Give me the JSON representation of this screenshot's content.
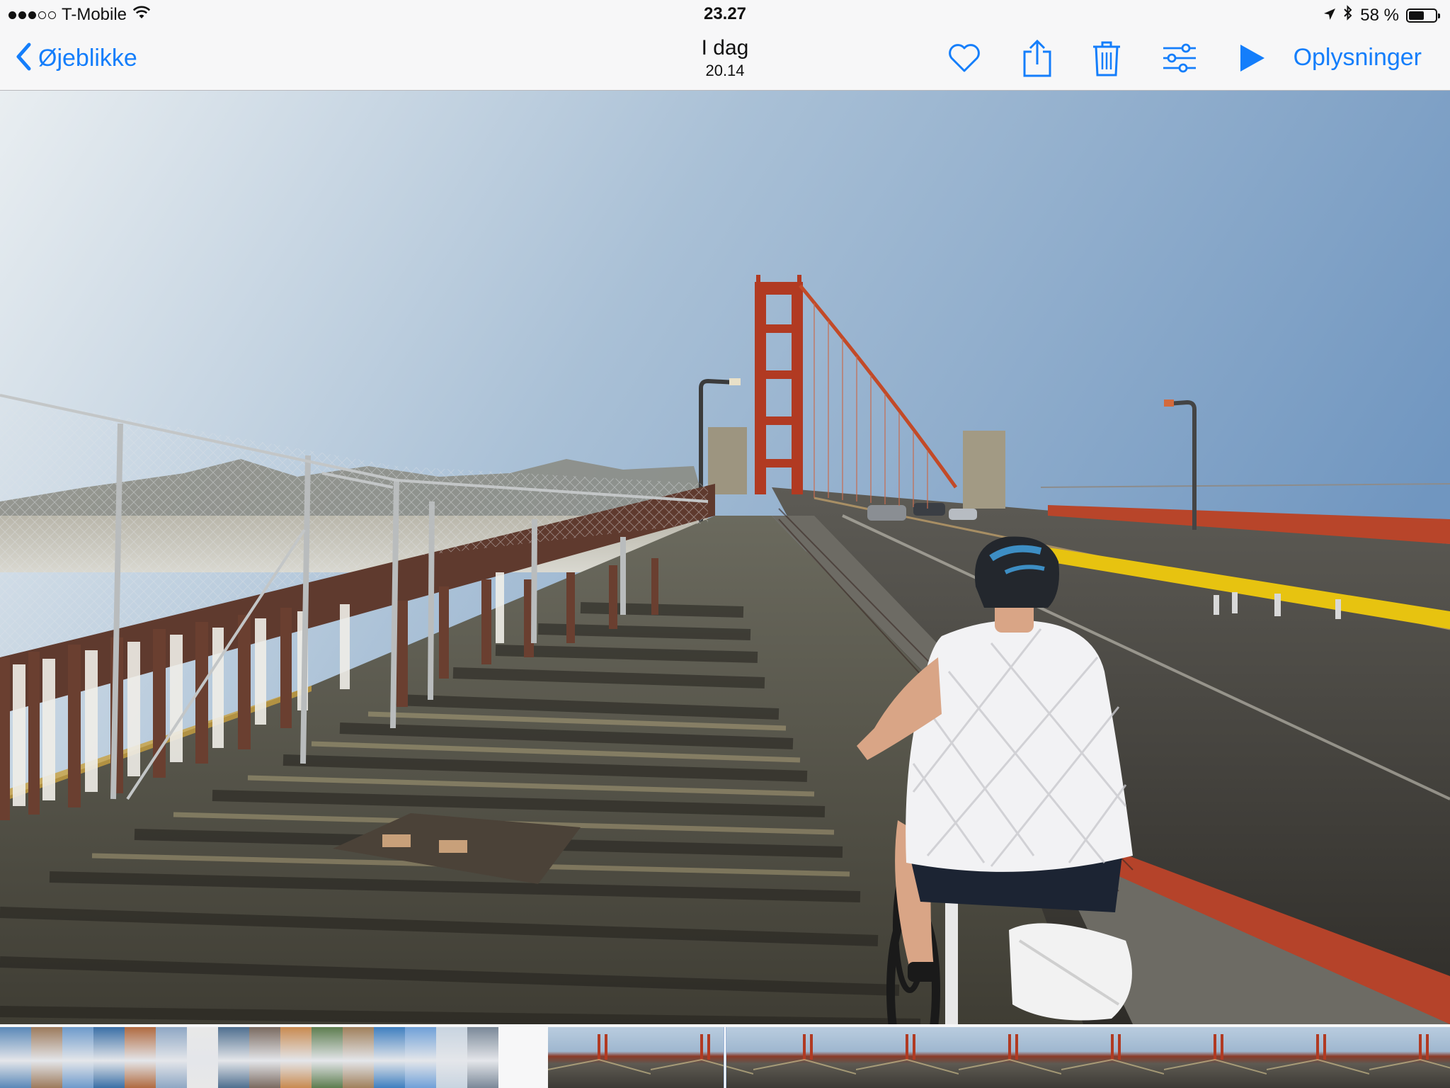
{
  "status_bar": {
    "carrier": "T-Mobile",
    "time": "23.27",
    "battery_text": "58 %",
    "signal_dots_filled": 3,
    "signal_dots_total": 5,
    "battery_level": 0.58
  },
  "nav": {
    "back_label": "Øjeblikke",
    "title": "I dag",
    "subtitle": "20.14",
    "info_label": "Oplysninger",
    "icons": [
      "heart-icon",
      "share-icon",
      "trash-icon",
      "adjust-icon",
      "play-icon"
    ]
  },
  "colors": {
    "accent": "#147efb",
    "bar_background": "#f7f7f8",
    "bridge_red": "#b8452a"
  },
  "filmstrip": {
    "city_thumbs": [
      "#5a88b8",
      "#9c7a5c",
      "#6d9acb",
      "#3a6fa6",
      "#b06a40",
      "#8ea7c4",
      "#e8e8e8",
      "#4f6f8f",
      "#7a6a60",
      "#c88a50",
      "#5d7d4f",
      "#a0805c",
      "#3f7fc0",
      "#6fa0d8",
      "#c8d4e0",
      "#7a8898"
    ],
    "bridge_thumbs": 9
  }
}
